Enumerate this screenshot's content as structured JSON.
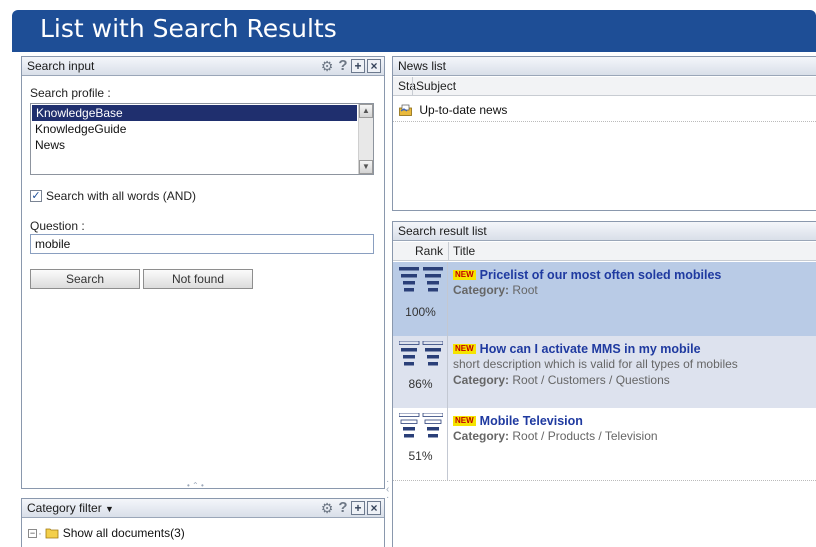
{
  "banner": {
    "title": "List with Search Results"
  },
  "search_panel": {
    "title": "Search input",
    "profile_label": "Search profile :",
    "profiles": [
      "KnowledgeBase",
      "KnowledgeGuide",
      "News"
    ],
    "selected_profile": "KnowledgeBase",
    "checkbox_label": "Search with all words (AND)",
    "checkbox_checked": true,
    "question_label": "Question :",
    "question_value": "mobile",
    "search_button": "Search",
    "notfound_button": "Not found"
  },
  "category_panel": {
    "title": "Category filter",
    "tree_root": "Show all documents(3)"
  },
  "news_panel": {
    "title": "News list",
    "col_status": "Sta",
    "col_subject": "Subject",
    "items": [
      {
        "subject": "Up-to-date news"
      }
    ]
  },
  "results_panel": {
    "title": "Search result list",
    "col_rank": "Rank",
    "col_title": "Title",
    "new_badge": "NEW",
    "category_label": "Category:",
    "results": [
      {
        "rank": "100%",
        "rank_value": 1.0,
        "title": "Pricelist of our most often soled mobiles",
        "description": "",
        "category": "Root"
      },
      {
        "rank": "86%",
        "rank_value": 0.86,
        "title": "How can I activate MMS in my mobile",
        "description": "short description which is valid for all types of mobiles",
        "category": "Root / Customers / Questions"
      },
      {
        "rank": "51%",
        "rank_value": 0.51,
        "title": "Mobile Television",
        "description": "",
        "category": "Root / Products / Television"
      }
    ]
  },
  "colors": {
    "banner": "#1e4e96",
    "selection": "#1f2f6e",
    "row_highlight": "#b9cbe6",
    "row_alt": "#dde2ee",
    "link": "#1f3aa0"
  }
}
